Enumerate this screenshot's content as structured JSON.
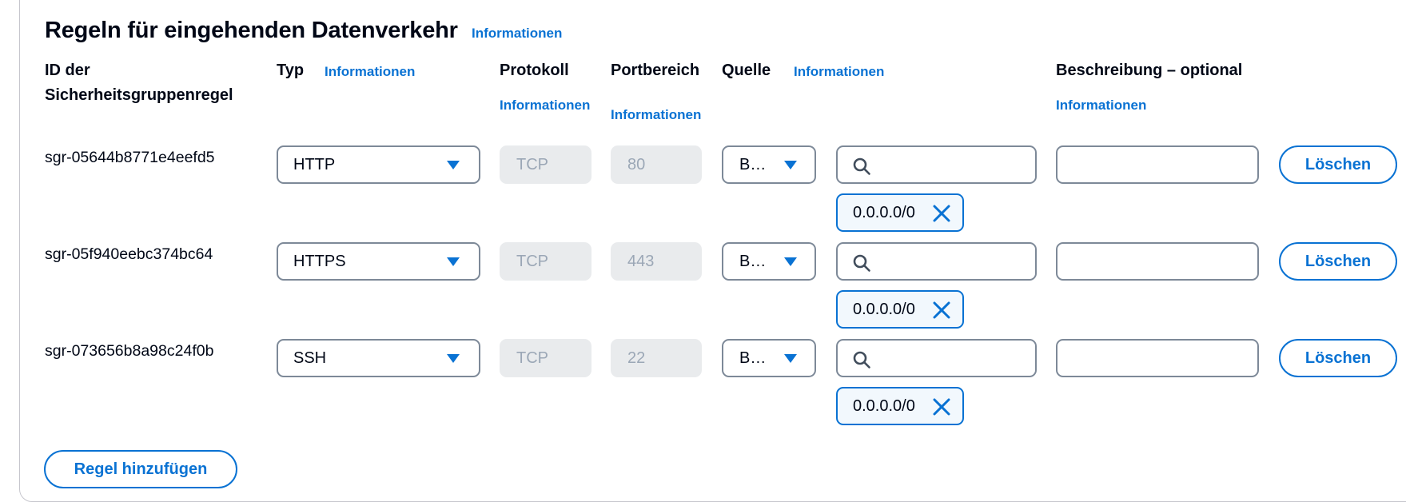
{
  "section": {
    "title": "Regeln für eingehenden Datenverkehr",
    "info_link": "Informationen"
  },
  "columns": {
    "rule_id_line1": "ID der",
    "rule_id_line2": "Sicherheitsgruppenregel",
    "type": "Typ",
    "type_info": "Informationen",
    "protocol": "Protokoll",
    "protocol_info": "Informationen",
    "port_range": "Portbereich",
    "port_range_info": "Informationen",
    "source": "Quelle",
    "source_info": "Informationen",
    "description": "Beschreibung – optional",
    "description_info": "Informationen"
  },
  "rules": [
    {
      "id": "sgr-05644b8771e4eefd5",
      "type": "HTTP",
      "protocol": "TCP",
      "port": "80",
      "source_type": "B…",
      "search_value": "",
      "cidr": "0.0.0.0/0",
      "description": "",
      "delete_label": "Löschen"
    },
    {
      "id": "sgr-05f940eebc374bc64",
      "type": "HTTPS",
      "protocol": "TCP",
      "port": "443",
      "source_type": "B…",
      "search_value": "",
      "cidr": "0.0.0.0/0",
      "description": "",
      "delete_label": "Löschen"
    },
    {
      "id": "sgr-073656b8a98c24f0b",
      "type": "SSH",
      "protocol": "TCP",
      "port": "22",
      "source_type": "B…",
      "search_value": "",
      "cidr": "0.0.0.0/0",
      "description": "",
      "delete_label": "Löschen"
    }
  ],
  "add_rule_label": "Regel hinzufügen",
  "colors": {
    "accent": "#0972d3",
    "border": "#7d8998",
    "disabled_bg": "#e9ebed",
    "disabled_text": "#9ba7b6",
    "token_bg": "#f2f8fd"
  },
  "icons": {
    "dropdown": "caret-down-icon",
    "search": "search-icon",
    "remove": "close-icon"
  }
}
